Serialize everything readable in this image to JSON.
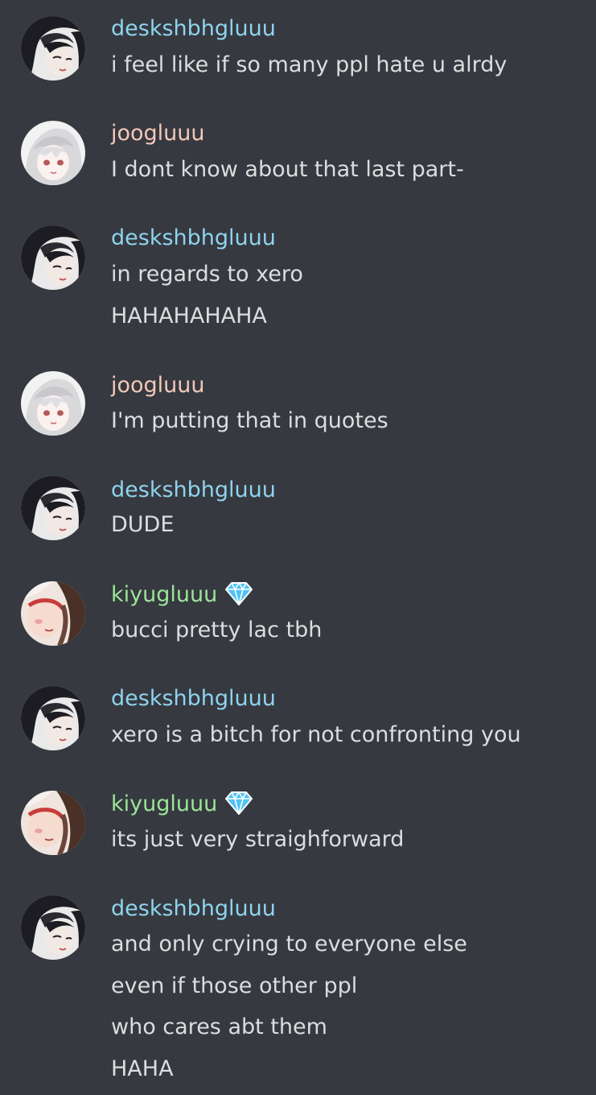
{
  "colors": {
    "background": "#36393f",
    "text": "#dcddde",
    "desk_name": "#8fd3ee",
    "joog_name": "#f3c8b9",
    "kiyu_name": "#9ce39a",
    "badge": "#4fc3f7"
  },
  "messages": [
    {
      "author": "deskshbhgluuu",
      "avatar_icon": "dark-haired-character-avatar",
      "lines": [
        "i feel like if so many ppl hate u alrdy"
      ]
    },
    {
      "author": "joogluuu",
      "avatar_icon": "white-haired-character-avatar",
      "lines": [
        "I dont know about that last part-"
      ]
    },
    {
      "author": "deskshbhgluuu",
      "avatar_icon": "dark-haired-character-avatar",
      "lines": [
        "in regards to xero",
        "HAHAHAHAHA"
      ]
    },
    {
      "author": "joogluuu",
      "avatar_icon": "white-haired-character-avatar",
      "lines": [
        "I'm putting that in quotes"
      ]
    },
    {
      "author": "deskshbhgluuu",
      "avatar_icon": "dark-haired-character-avatar",
      "lines": [
        "DUDE"
      ]
    },
    {
      "author": "kiyugluuu",
      "avatar_icon": "brown-haired-character-avatar",
      "badge_icon": "diamond-badge-icon",
      "lines": [
        "bucci pretty lac tbh"
      ]
    },
    {
      "author": "deskshbhgluuu",
      "avatar_icon": "dark-haired-character-avatar",
      "lines": [
        "xero is a bitch for not confronting you"
      ]
    },
    {
      "author": "kiyugluuu",
      "avatar_icon": "brown-haired-character-avatar",
      "badge_icon": "diamond-badge-icon",
      "lines": [
        "its just very straighforward"
      ]
    },
    {
      "author": "deskshbhgluuu",
      "avatar_icon": "dark-haired-character-avatar",
      "lines": [
        "and only crying to everyone else",
        "even if those other ppl",
        "who cares abt them",
        "HAHA"
      ]
    }
  ]
}
